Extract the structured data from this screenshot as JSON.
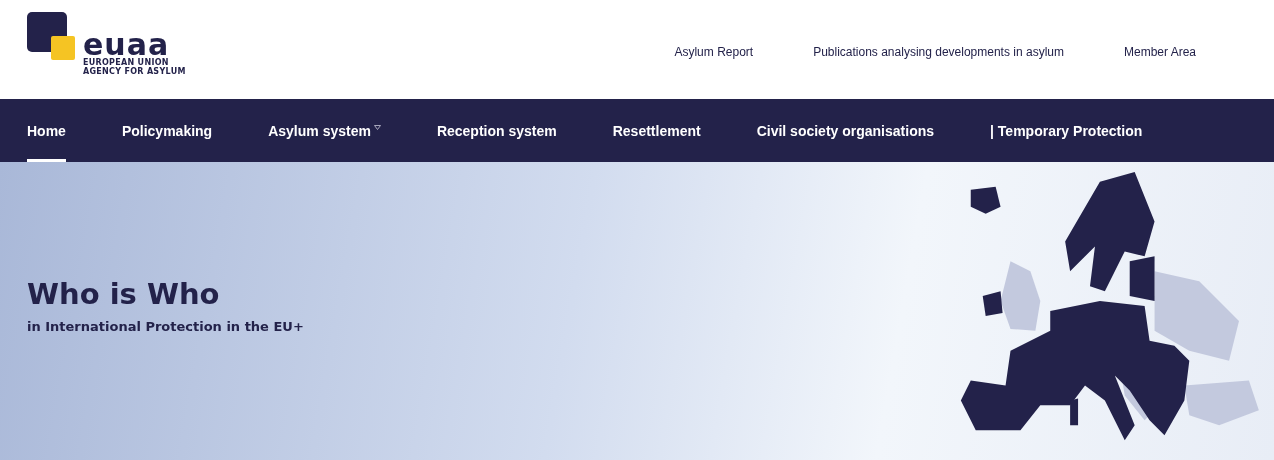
{
  "logo": {
    "wordmark": "euaa",
    "line_1": "EUROPEAN UNION",
    "line_2": "AGENCY FOR ASYLUM"
  },
  "top_links": [
    "Asylum Report",
    "Publications analysing developments in asylum",
    "Member Area"
  ],
  "nav": [
    {
      "label": "Home",
      "selected": true,
      "dropdown": false
    },
    {
      "label": "Policymaking",
      "selected": false,
      "dropdown": false
    },
    {
      "label": "Asylum system",
      "selected": false,
      "dropdown": true
    },
    {
      "label": "Reception system",
      "selected": false,
      "dropdown": false
    },
    {
      "label": "Resettlement",
      "selected": false,
      "dropdown": false
    },
    {
      "label": "Civil society organisations",
      "selected": false,
      "dropdown": false
    },
    {
      "label": "| Temporary Protection",
      "selected": false,
      "dropdown": false
    }
  ],
  "hero": {
    "title": "Who is Who",
    "subtitle": "in International Protection in the EU+"
  }
}
